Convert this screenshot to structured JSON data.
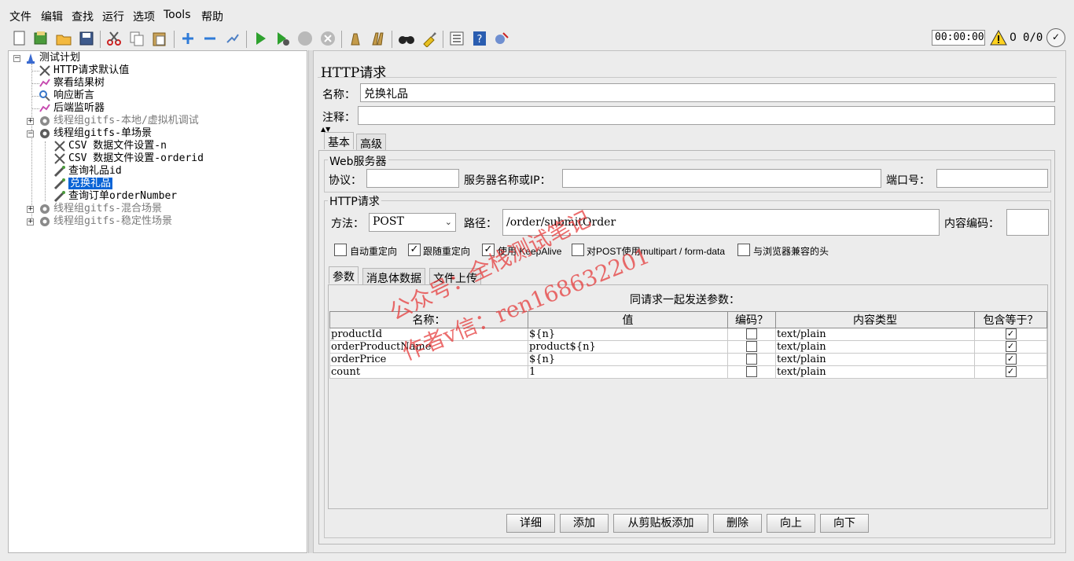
{
  "menu": [
    "文件",
    "编辑",
    "查找",
    "运行",
    "选项",
    "Tools",
    "帮助"
  ],
  "toolbar": {
    "icons": [
      "new-icon",
      "templates-icon",
      "open-icon",
      "save-icon",
      "cut-icon",
      "copy-icon",
      "paste-icon",
      "expand-icon",
      "collapse-icon",
      "toggle-icon",
      "start-icon",
      "start-no-pause-icon",
      "stop-icon",
      "shutdown-icon",
      "clear-icon",
      "clear-all-icon",
      "search-icon",
      "reset-search-icon",
      "function-helper-icon",
      "help-icon",
      "remote-icon"
    ],
    "timer": "00:00:00",
    "warning_count": "0",
    "thread_count": "0/0"
  },
  "tree": {
    "items": [
      {
        "label": "测试计划",
        "icon": "test-plan-icon"
      },
      {
        "label": "HTTP请求默认值",
        "icon": "config-icon"
      },
      {
        "label": "察看结果树",
        "icon": "listener-icon"
      },
      {
        "label": "响应断言",
        "icon": "assertion-icon"
      },
      {
        "label": "后端监听器",
        "icon": "listener-icon"
      },
      {
        "label": "线程组gitfs-本地/虚拟机调试",
        "icon": "thread-group-icon"
      },
      {
        "label": "线程组gitfs-单场景",
        "icon": "thread-group-icon"
      },
      {
        "label": "CSV 数据文件设置-n",
        "icon": "config-icon"
      },
      {
        "label": "CSV 数据文件设置-orderid",
        "icon": "config-icon"
      },
      {
        "label": "查询礼品id",
        "icon": "sampler-icon"
      },
      {
        "label": "兑换礼品",
        "icon": "sampler-icon"
      },
      {
        "label": "查询订单orderNumber",
        "icon": "sampler-icon"
      },
      {
        "label": "线程组gitfs-混合场景",
        "icon": "thread-group-icon"
      },
      {
        "label": "线程组gitfs-稳定性场景",
        "icon": "thread-group-icon"
      }
    ]
  },
  "panel": {
    "title": "HTTP请求",
    "name_label": "名称：",
    "name_value": "兑换礼品",
    "comment_label": "注释：",
    "comment_value": "",
    "tabs": [
      "基本",
      "高级"
    ],
    "web_server": {
      "title": "Web服务器",
      "protocol_label": "协议：",
      "protocol_value": "",
      "server_label": "服务器名称或IP：",
      "server_value": "",
      "port_label": "端口号：",
      "port_value": ""
    },
    "http_request": {
      "title": "HTTP请求",
      "method_label": "方法：",
      "method_value": "POST",
      "path_label": "路径：",
      "path_value": "/order/submitOrder",
      "encoding_label": "内容编码：",
      "encoding_value": ""
    },
    "checkboxes": [
      {
        "label": "自动重定向",
        "checked": false
      },
      {
        "label": "跟随重定向",
        "checked": true
      },
      {
        "label": "使用 KeepAlive",
        "checked": true
      },
      {
        "label": "对POST使用multipart / form-data",
        "checked": false
      },
      {
        "label": "与浏览器兼容的头",
        "checked": false
      }
    ],
    "sub_tabs": [
      "参数",
      "消息体数据",
      "文件上传"
    ],
    "params_caption": "同请求一起发送参数：",
    "columns": [
      "名称：",
      "值",
      "编码？",
      "内容类型",
      "包含等于？"
    ],
    "rows": [
      {
        "name": "productId",
        "value": "${n}",
        "encode": false,
        "content_type": "text/plain",
        "include_equals": true
      },
      {
        "name": "orderProductName",
        "value": "product${n}",
        "encode": false,
        "content_type": "text/plain",
        "include_equals": true
      },
      {
        "name": "orderPrice",
        "value": "${n}",
        "encode": false,
        "content_type": "text/plain",
        "include_equals": true
      },
      {
        "name": "count",
        "value": "1",
        "encode": false,
        "content_type": "text/plain",
        "include_equals": true
      }
    ],
    "buttons": [
      "详细",
      "添加",
      "从剪贴板添加",
      "删除",
      "向上",
      "向下"
    ]
  },
  "watermark": {
    "line1": "公众号：全栈测试笔记",
    "line2": "作者v信：ren168632201"
  }
}
